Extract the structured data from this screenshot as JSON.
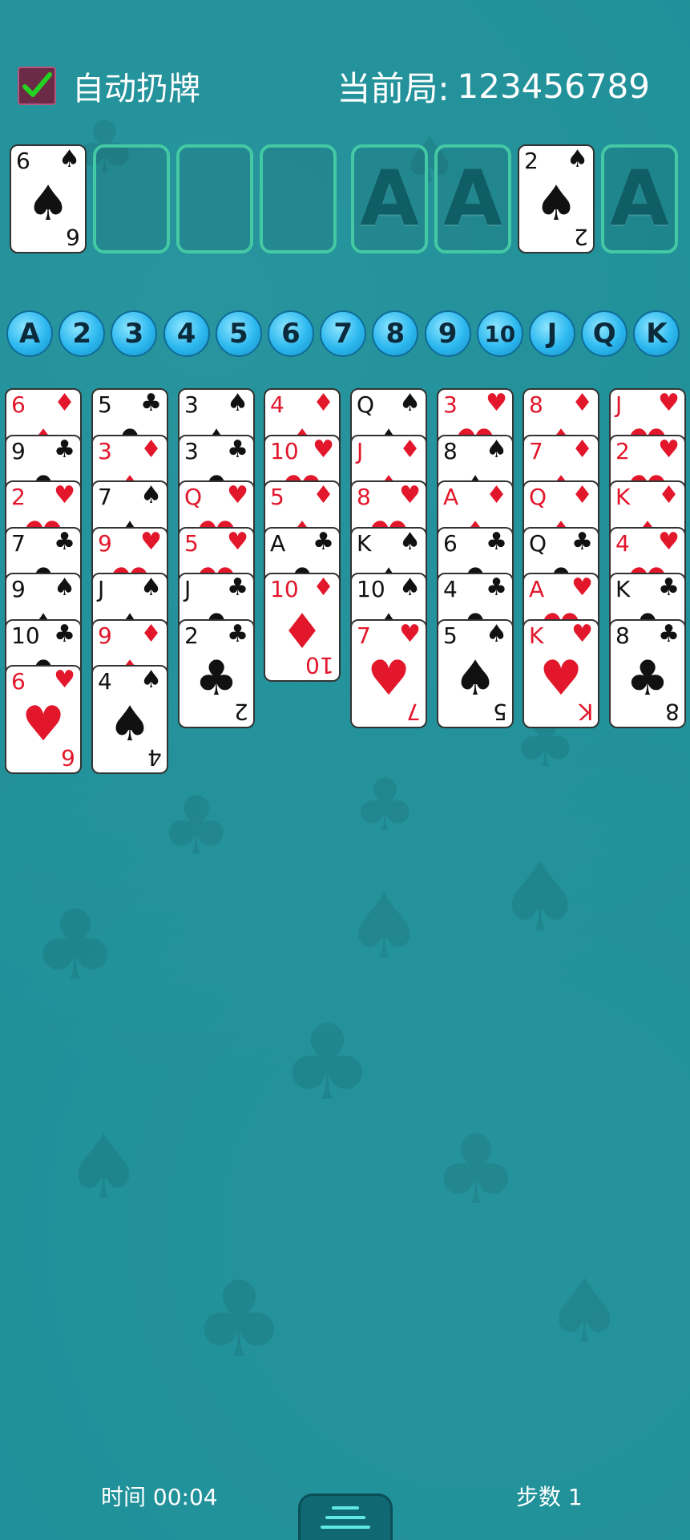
{
  "header": {
    "auto_discard_label": "自动扔牌",
    "auto_discard_checked": true,
    "game_number_label": "当前局:",
    "game_number_value": "123456789"
  },
  "free_cells": [
    {
      "rank": "6",
      "suit": "spade",
      "color": "black"
    },
    null,
    null,
    null
  ],
  "foundations": [
    {
      "empty_label": "A"
    },
    {
      "empty_label": "A"
    },
    {
      "rank": "2",
      "suit": "spade",
      "color": "black"
    },
    {
      "empty_label": "A"
    }
  ],
  "rank_buttons": [
    "A",
    "2",
    "3",
    "4",
    "5",
    "6",
    "7",
    "8",
    "9",
    "10",
    "J",
    "Q",
    "K"
  ],
  "tableau": [
    [
      {
        "rank": "6",
        "suit": "diamond",
        "color": "red"
      },
      {
        "rank": "9",
        "suit": "club",
        "color": "black"
      },
      {
        "rank": "2",
        "suit": "heart",
        "color": "red"
      },
      {
        "rank": "7",
        "suit": "club",
        "color": "black"
      },
      {
        "rank": "9",
        "suit": "spade",
        "color": "black"
      },
      {
        "rank": "10",
        "suit": "club",
        "color": "black"
      },
      {
        "rank": "6",
        "suit": "heart",
        "color": "red"
      }
    ],
    [
      {
        "rank": "5",
        "suit": "club",
        "color": "black"
      },
      {
        "rank": "3",
        "suit": "diamond",
        "color": "red"
      },
      {
        "rank": "7",
        "suit": "spade",
        "color": "black"
      },
      {
        "rank": "9",
        "suit": "heart",
        "color": "red"
      },
      {
        "rank": "J",
        "suit": "spade",
        "color": "black"
      },
      {
        "rank": "9",
        "suit": "diamond",
        "color": "red"
      },
      {
        "rank": "4",
        "suit": "spade",
        "color": "black"
      }
    ],
    [
      {
        "rank": "3",
        "suit": "spade",
        "color": "black"
      },
      {
        "rank": "3",
        "suit": "club",
        "color": "black"
      },
      {
        "rank": "Q",
        "suit": "heart",
        "color": "red"
      },
      {
        "rank": "5",
        "suit": "heart",
        "color": "red"
      },
      {
        "rank": "J",
        "suit": "club",
        "color": "black"
      },
      {
        "rank": "2",
        "suit": "club",
        "color": "black"
      }
    ],
    [
      {
        "rank": "4",
        "suit": "diamond",
        "color": "red"
      },
      {
        "rank": "10",
        "suit": "heart",
        "color": "red"
      },
      {
        "rank": "5",
        "suit": "diamond",
        "color": "red"
      },
      {
        "rank": "A",
        "suit": "club",
        "color": "black"
      },
      {
        "rank": "10",
        "suit": "diamond",
        "color": "red"
      }
    ],
    [
      {
        "rank": "Q",
        "suit": "spade",
        "color": "black"
      },
      {
        "rank": "J",
        "suit": "diamond",
        "color": "red"
      },
      {
        "rank": "8",
        "suit": "heart",
        "color": "red"
      },
      {
        "rank": "K",
        "suit": "spade",
        "color": "black"
      },
      {
        "rank": "10",
        "suit": "spade",
        "color": "black"
      },
      {
        "rank": "7",
        "suit": "heart",
        "color": "red"
      }
    ],
    [
      {
        "rank": "3",
        "suit": "heart",
        "color": "red"
      },
      {
        "rank": "8",
        "suit": "spade",
        "color": "black"
      },
      {
        "rank": "A",
        "suit": "diamond",
        "color": "red"
      },
      {
        "rank": "6",
        "suit": "club",
        "color": "black"
      },
      {
        "rank": "4",
        "suit": "club",
        "color": "black"
      },
      {
        "rank": "5",
        "suit": "spade",
        "color": "black"
      }
    ],
    [
      {
        "rank": "8",
        "suit": "diamond",
        "color": "red"
      },
      {
        "rank": "7",
        "suit": "diamond",
        "color": "red"
      },
      {
        "rank": "Q",
        "suit": "diamond",
        "color": "red"
      },
      {
        "rank": "Q",
        "suit": "club",
        "color": "black"
      },
      {
        "rank": "A",
        "suit": "heart",
        "color": "red"
      },
      {
        "rank": "K",
        "suit": "heart",
        "color": "red"
      }
    ],
    [
      {
        "rank": "J",
        "suit": "heart",
        "color": "red"
      },
      {
        "rank": "2",
        "suit": "heart",
        "color": "red"
      },
      {
        "rank": "K",
        "suit": "diamond",
        "color": "red"
      },
      {
        "rank": "4",
        "suit": "heart",
        "color": "red"
      },
      {
        "rank": "K",
        "suit": "club",
        "color": "black"
      },
      {
        "rank": "8",
        "suit": "club",
        "color": "black"
      }
    ]
  ],
  "footer": {
    "time_label": "时间 00:04",
    "moves_label": "步数 1"
  },
  "colors": {
    "felt": "#1d8f98",
    "slot_border": "#44c9a4",
    "rank_button": "#2cb8ef",
    "red_suit": "#e2172b",
    "black_suit": "#111111"
  },
  "icons": {
    "checkbox": "check-icon",
    "menu": "menu-icon"
  }
}
